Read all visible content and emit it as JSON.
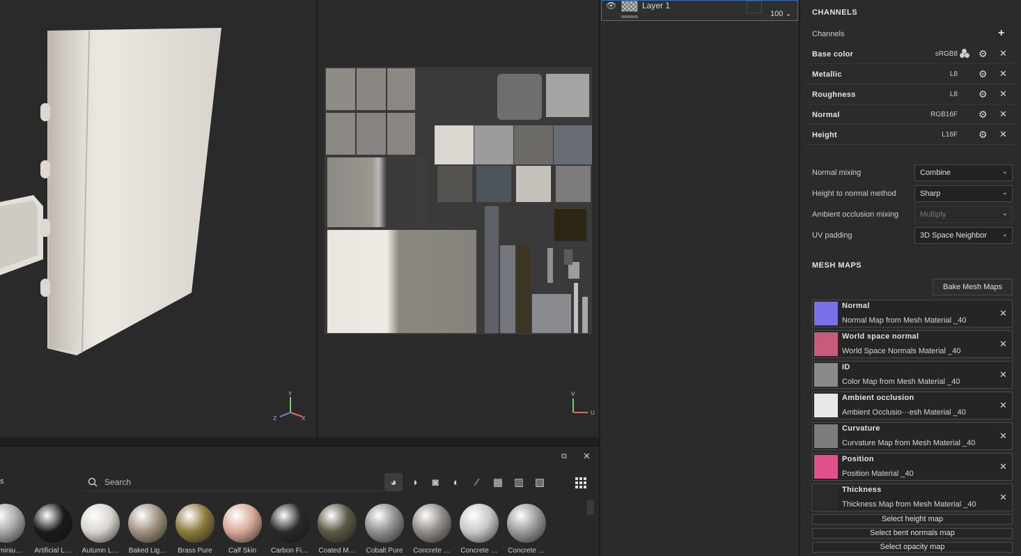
{
  "viewport3d": {
    "axis_labels": [
      "Y",
      "Z",
      "X"
    ]
  },
  "viewport2d": {
    "axis_labels": [
      "V",
      "U"
    ]
  },
  "asset_browser": {
    "search_placeholder": "Search",
    "filter_icons": [
      "material-filter-icon",
      "smart-material-filter-icon",
      "mask-filter-icon",
      "generator-filter-icon",
      "brush-filter-icon",
      "alpha-filter-icon",
      "grunge-filter-icon",
      "environment-filter-icon"
    ],
    "materials": [
      {
        "label": "Aluminiu…",
        "color": "#a9a9a9"
      },
      {
        "label": "Artificial L…",
        "color": "#1a1a1a"
      },
      {
        "label": "Autumn L…",
        "color": "#d9d4cf"
      },
      {
        "label": "Baked Lig…",
        "color": "#9f917e"
      },
      {
        "label": "Brass Pure",
        "color": "#8b7a3b"
      },
      {
        "label": "Calf Skin",
        "color": "#d7a896"
      },
      {
        "label": "Carbon Fi…",
        "color": "#2a2a2a"
      },
      {
        "label": "Coated M…",
        "color": "#5c5845"
      },
      {
        "label": "Cobalt Pure",
        "color": "#8e8e90"
      },
      {
        "label": "Concrete …",
        "color": "#8f8a84"
      },
      {
        "label": "Concrete …",
        "color": "#c7c7c9"
      },
      {
        "label": "Concrete …",
        "color": "#9a9998"
      }
    ]
  },
  "layers": {
    "items": [
      {
        "name": "Layer 1",
        "opacity": "100"
      }
    ]
  },
  "properties": {
    "channels_title": "CHANNELS",
    "channels_label": "Channels",
    "channels": [
      {
        "name": "Base color",
        "format": "sRGB8"
      },
      {
        "name": "Metallic",
        "format": "L8"
      },
      {
        "name": "Roughness",
        "format": "L8"
      },
      {
        "name": "Normal",
        "format": "RGB16F"
      },
      {
        "name": "Height",
        "format": "L16F"
      }
    ],
    "options": [
      {
        "label": "Normal mixing",
        "value": "Combine",
        "disabled": false
      },
      {
        "label": "Height to normal method",
        "value": "Sharp",
        "disabled": false
      },
      {
        "label": "Ambient occlusion mixing",
        "value": "Multiply",
        "disabled": true
      },
      {
        "label": "UV padding",
        "value": "3D Space Neighbor",
        "disabled": false
      }
    ],
    "mesh_maps_title": "MESH MAPS",
    "bake_button": "Bake Mesh Maps",
    "mesh_maps": [
      {
        "name": "Normal",
        "desc": "Normal Map from Mesh Material _40",
        "color": "#7a70e8"
      },
      {
        "name": "World space normal",
        "desc": "World Space Normals Material _40",
        "color": "#c85a7a"
      },
      {
        "name": "ID",
        "desc": "Color Map from Mesh Material _40",
        "color": "#8a8a8a"
      },
      {
        "name": "Ambient occlusion",
        "desc": "Ambient Occlusio···esh Material _40",
        "color": "#e8e8e8"
      },
      {
        "name": "Curvature",
        "desc": "Curvature Map from Mesh Material _40",
        "color": "#7c7c7c"
      },
      {
        "name": "Position",
        "desc": "Position Material _40",
        "color": "#e0508a"
      },
      {
        "name": "Thickness",
        "desc": "Thickness Map from Mesh Material _40",
        "color": "#2a2a2a"
      }
    ],
    "select_buttons": [
      "Select height map",
      "Select bent normals map",
      "Select opacity map"
    ]
  }
}
